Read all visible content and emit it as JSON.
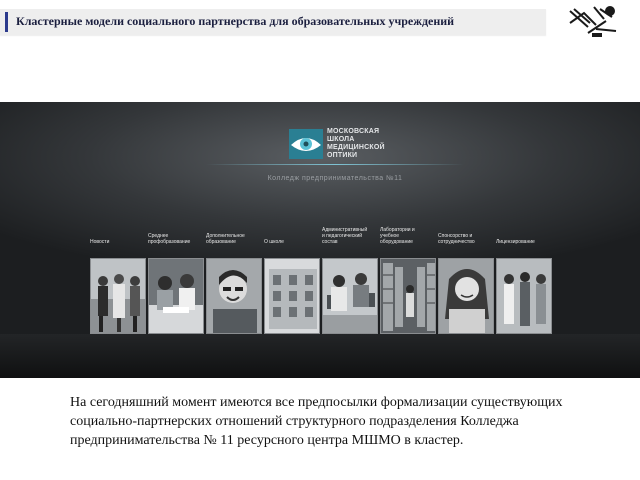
{
  "header": {
    "title": "Кластерные модели социального партнерства для образовательных учреждений"
  },
  "site": {
    "logo_lines": [
      "МОСКОВСКАЯ",
      "ШКОЛА",
      "МЕДИЦИНСКОЙ",
      "ОПТИКИ"
    ],
    "subtitle": "Колледж предпринимательства №11",
    "nav": [
      {
        "line1": "Новости",
        "line2": "",
        "photo": "group-of-students"
      },
      {
        "line1": "Среднее",
        "line2": "профобразование",
        "photo": "students-at-desk"
      },
      {
        "line1": "Дополнительное",
        "line2": "образование",
        "photo": "smiling-student"
      },
      {
        "line1": "О школе",
        "line2": "",
        "photo": "building"
      },
      {
        "line1": "Административный",
        "line2": "и педагогический",
        "line3": "состав",
        "photo": "students-at-computers"
      },
      {
        "line1": "Лаборатории и",
        "line2": "учебное",
        "line3": "оборудование",
        "photo": "library-shelves"
      },
      {
        "line1": "Спонсорство и",
        "line2": "сотрудничество",
        "photo": "smiling-woman"
      },
      {
        "line1": "Лицензирование",
        "line2": "",
        "photo": "group-standing"
      }
    ]
  },
  "content": {
    "paragraph": "На сегодняшний момент имеются все предпосылки формализации существующих социально-партнерских отношений структурного подразделения Колледжа предпринимательства № 11 ресурсного центра МШМО в кластер."
  },
  "colors": {
    "header_bg": "#eeeeee",
    "header_accent": "#2b3a8c",
    "site_bg": "#34373a",
    "logo_cyan": "#5bc2d6"
  }
}
